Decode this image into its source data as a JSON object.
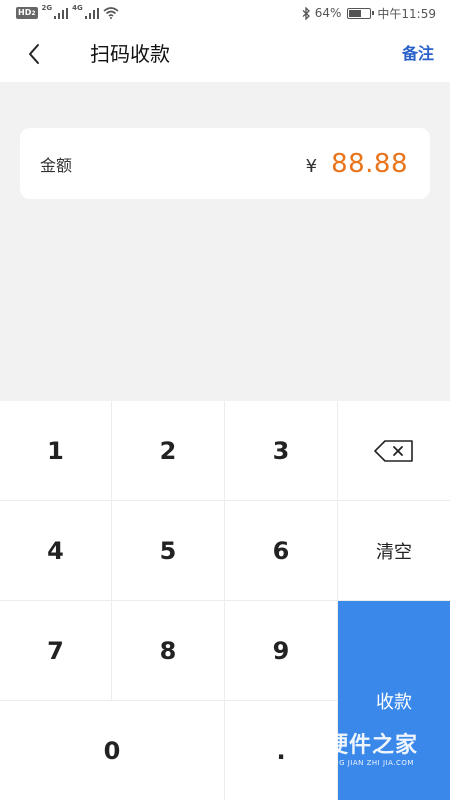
{
  "status_bar": {
    "hd": "HD",
    "hd_sub": "2",
    "net1": "2G",
    "net2": "4G",
    "battery_percent": "64%",
    "battery_level": 0.64,
    "time": "中午11:59"
  },
  "header": {
    "title": "扫码收款",
    "note_label": "备注"
  },
  "amount": {
    "label": "金额",
    "currency": "¥",
    "value": "88.88"
  },
  "keypad": {
    "k1": "1",
    "k2": "2",
    "k3": "3",
    "k4": "4",
    "k5": "5",
    "k6": "6",
    "k7": "7",
    "k8": "8",
    "k9": "9",
    "k0": "0",
    "kdot": ".",
    "clear_label": "清空",
    "pay_label": "收款"
  },
  "colors": {
    "accent_blue": "#2a62c9",
    "pay_button": "#3a88ea",
    "amount_orange": "#e8741c"
  },
  "watermark": {
    "title": "硬件之家",
    "subtitle": "YING JIAN ZHI JIA.COM"
  }
}
